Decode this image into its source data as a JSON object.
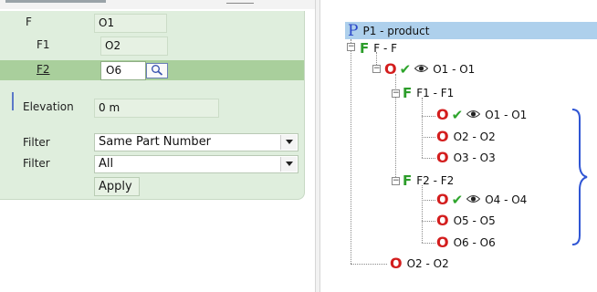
{
  "left_panel": {
    "rows": [
      {
        "label": "F",
        "value": "O1"
      },
      {
        "label": "F1",
        "value": "O2"
      },
      {
        "label": "F2",
        "value": "O6"
      }
    ],
    "elevation": {
      "label": "Elevation",
      "value": "0 m"
    },
    "filters": [
      {
        "label": "Filter",
        "value": "Same Part Number"
      },
      {
        "label": "Filter",
        "value": "All"
      }
    ],
    "apply_label": "Apply",
    "colors": {
      "panel": "#dfeedd",
      "selected_row": "#a9cf9c"
    }
  },
  "tree": {
    "root": {
      "letter": "P",
      "text": "P1 - product"
    },
    "nodes": [
      {
        "letter": "F",
        "text": "F - F"
      },
      {
        "letter": "O",
        "text": "O1 - O1"
      },
      {
        "letter": "F",
        "text": "F1 - F1"
      },
      {
        "letter": "O",
        "text": "O1 - O1"
      },
      {
        "letter": "O",
        "text": "O2 - O2"
      },
      {
        "letter": "O",
        "text": "O3 - O3"
      },
      {
        "letter": "F",
        "text": "F2 - F2"
      },
      {
        "letter": "O",
        "text": "O4 - O4"
      },
      {
        "letter": "O",
        "text": "O5 - O5"
      },
      {
        "letter": "O",
        "text": "O6 - O6"
      },
      {
        "letter": "O",
        "text": "O2 - O2"
      }
    ],
    "expander_symbol": "−",
    "colors": {
      "root_highlight": "#aed0ec",
      "option_red": "#d31d1d",
      "family_green": "#2c9d2a",
      "product_blue": "#2b47c9",
      "brace": "#2f55d4"
    }
  }
}
